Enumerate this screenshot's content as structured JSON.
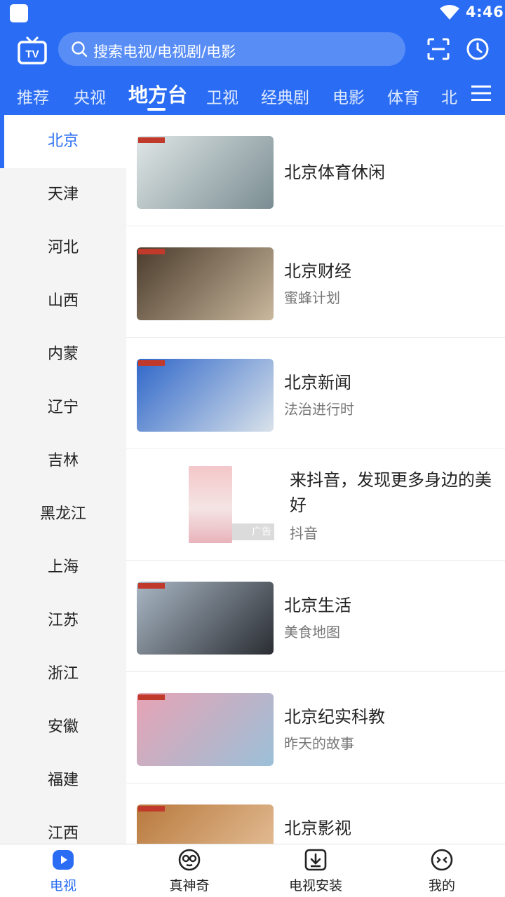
{
  "status_bar": {
    "time": "4:46"
  },
  "header": {
    "search_placeholder": "搜索电视/电视剧/电影",
    "logo_icon": "tv-logo-icon",
    "scan_icon": "scan-icon",
    "history_icon": "clock-icon"
  },
  "tabs": [
    {
      "label": "推荐"
    },
    {
      "label": "央视"
    },
    {
      "label": "地方台",
      "active": true
    },
    {
      "label": "卫视"
    },
    {
      "label": "经典剧"
    },
    {
      "label": "电影"
    },
    {
      "label": "体育"
    },
    {
      "label": "北"
    }
  ],
  "sidebar": {
    "items": [
      {
        "label": "北京",
        "active": true
      },
      {
        "label": "天津"
      },
      {
        "label": "河北"
      },
      {
        "label": "山西"
      },
      {
        "label": "内蒙"
      },
      {
        "label": "辽宁"
      },
      {
        "label": "吉林"
      },
      {
        "label": "黑龙江"
      },
      {
        "label": "上海"
      },
      {
        "label": "江苏"
      },
      {
        "label": "浙江"
      },
      {
        "label": "安徽"
      },
      {
        "label": "福建"
      },
      {
        "label": "江西"
      }
    ]
  },
  "channels": [
    {
      "title": "北京体育休闲",
      "subtitle": "",
      "thumb_colors": [
        "#dfe6e6",
        "#7a8d92"
      ]
    },
    {
      "title": "北京财经",
      "subtitle": "蜜蜂计划",
      "thumb_colors": [
        "#4a3b2c",
        "#c9b89d"
      ]
    },
    {
      "title": "北京新闻",
      "subtitle": "法治进行时",
      "thumb_colors": [
        "#2f67c9",
        "#d9e2ea"
      ]
    },
    {
      "ad": true,
      "title": "来抖音，发现更多身边的美好",
      "subtitle": "抖音",
      "badge": "广告"
    },
    {
      "title": "北京生活",
      "subtitle": "美食地图",
      "thumb_colors": [
        "#a9b7c4",
        "#2a2d33"
      ]
    },
    {
      "title": "北京纪实科教",
      "subtitle": "昨天的故事",
      "thumb_colors": [
        "#e7a3b4",
        "#9bc0d8"
      ]
    },
    {
      "title": "北京影视",
      "subtitle": "",
      "thumb_colors": [
        "#b8793d",
        "#e9c6a0"
      ]
    }
  ],
  "bottom_nav": [
    {
      "label": "电视",
      "icon": "tv-play-icon",
      "active": true
    },
    {
      "label": "真神奇",
      "icon": "face-icon"
    },
    {
      "label": "电视安装",
      "icon": "download-icon"
    },
    {
      "label": "我的",
      "icon": "profile-icon"
    }
  ],
  "colors": {
    "accent": "#2a6df4",
    "sidebar_bg": "#f4f4f4"
  }
}
